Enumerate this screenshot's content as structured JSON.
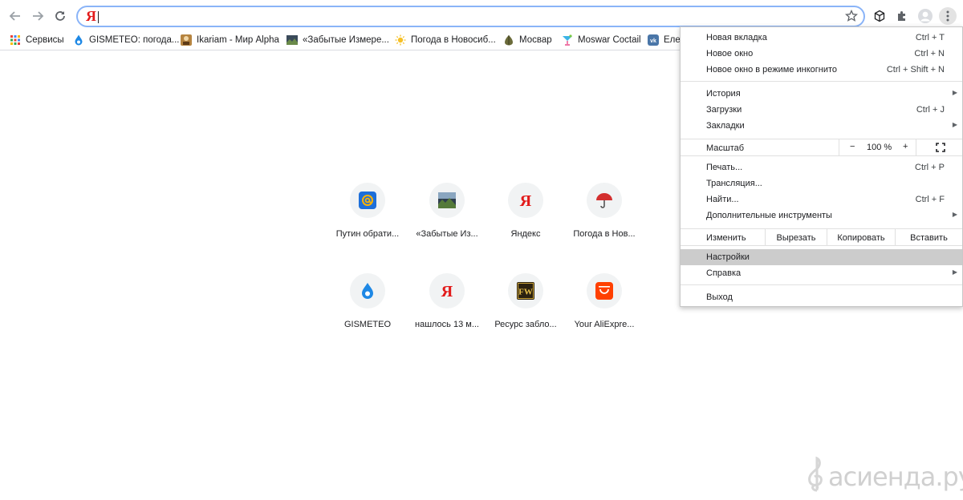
{
  "omnibox": {
    "value": "Я"
  },
  "bookmarks": [
    {
      "label": "Сервисы",
      "icon": "apps-grid-icon"
    },
    {
      "label": "GISMETEO: погода...",
      "icon": "gismeteo-drop-icon"
    },
    {
      "label": "Ikariam - Мир Alpha",
      "icon": "ikariam-icon"
    },
    {
      "label": "«Забытые Измере...",
      "icon": "landscape-thumb-icon"
    },
    {
      "label": "Погода в Новосиб...",
      "icon": "sun-icon"
    },
    {
      "label": "Мосвар",
      "icon": "mosvar-icon"
    },
    {
      "label": "Moswar Coctail",
      "icon": "cocktail-icon"
    },
    {
      "label": "Еле",
      "icon": "vk-icon"
    }
  ],
  "tiles": [
    {
      "label": "Путин обрати...",
      "icon": "mail-at-icon"
    },
    {
      "label": "«Забытые Из...",
      "icon": "landscape-thumb-icon"
    },
    {
      "label": "Яндекс",
      "icon": "yandex-icon"
    },
    {
      "label": "Погода в Нов...",
      "icon": "umbrella-icon"
    },
    {
      "label": "GISMETEO",
      "icon": "gismeteo-drop-icon"
    },
    {
      "label": "нашлось 13 м...",
      "icon": "yandex-icon"
    },
    {
      "label": "Ресурс забло...",
      "icon": "fw-icon"
    },
    {
      "label": "Your AliExpre...",
      "icon": "aliexpress-icon"
    }
  ],
  "menu": {
    "group1": [
      {
        "label": "Новая вкладка",
        "shortcut": "Ctrl + T"
      },
      {
        "label": "Новое окно",
        "shortcut": "Ctrl + N"
      },
      {
        "label": "Новое окно в режиме инкогнито",
        "shortcut": "Ctrl + Shift + N"
      }
    ],
    "group2": [
      {
        "label": "История",
        "shortcut": "",
        "arrow": "▶"
      },
      {
        "label": "Загрузки",
        "shortcut": "Ctrl + J"
      },
      {
        "label": "Закладки",
        "shortcut": "",
        "arrow": "▶"
      }
    ],
    "zoom": {
      "label": "Масштаб",
      "minus": "−",
      "value": "100 %",
      "plus": "+"
    },
    "group3": [
      {
        "label": "Печать...",
        "shortcut": "Ctrl + P"
      },
      {
        "label": "Трансляция...",
        "shortcut": ""
      },
      {
        "label": "Найти...",
        "shortcut": "Ctrl + F"
      },
      {
        "label": "Дополнительные инструменты",
        "shortcut": "",
        "arrow": "▶"
      }
    ],
    "edit": {
      "label": "Изменить",
      "cut": "Вырезать",
      "copy": "Копировать",
      "paste": "Вставить"
    },
    "group4": [
      {
        "label": "Настройки",
        "highlighted": true
      },
      {
        "label": "Справка",
        "arrow": "▶"
      }
    ],
    "exit": {
      "label": "Выход"
    }
  },
  "watermark": {
    "text": "асиенда.ру"
  },
  "colors": {
    "accent": "#8ab4f8",
    "highlight": "#cccccc",
    "yandex_red": "#e21b1b"
  }
}
